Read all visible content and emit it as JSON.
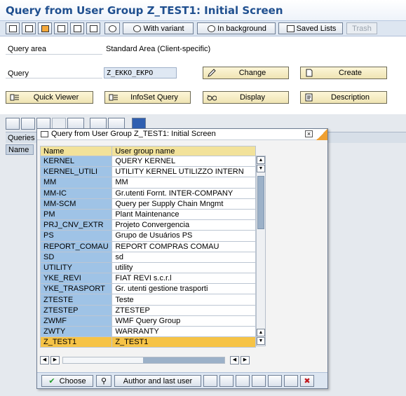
{
  "page": {
    "title": "Query from User Group Z_TEST1: Initial Screen"
  },
  "toolbar": {
    "with_variant": "With variant",
    "in_background": "In background",
    "saved_lists": "Saved Lists",
    "trash": "Trash"
  },
  "form": {
    "query_area_label": "Query area",
    "query_area_value": "Standard Area (Client-specific)",
    "query_label": "Query",
    "query_value": "Z_EKKO_EKPO"
  },
  "buttons": {
    "change": "Change",
    "create": "Create",
    "quick_viewer": "Quick Viewer",
    "infoset_query": "InfoSet Query",
    "display": "Display",
    "description": "Description"
  },
  "list": {
    "queries_label": "Queries",
    "name_header": "Name"
  },
  "popup": {
    "title": "Query from User Group Z_TEST1: Initial Screen",
    "col_name": "Name",
    "col_group": "User group name",
    "rows": [
      {
        "name": "KERNEL",
        "group": "QUERY KERNEL"
      },
      {
        "name": "KERNEL_UTILI",
        "group": "UTILITY KERNEL UTILIZZO INTERN"
      },
      {
        "name": "MM",
        "group": "MM"
      },
      {
        "name": "MM-IC",
        "group": "Gr.utenti Fornt. INTER-COMPANY"
      },
      {
        "name": "MM-SCM",
        "group": "Query per Supply Chain Mngmt"
      },
      {
        "name": "PM",
        "group": "Plant  Maintenance"
      },
      {
        "name": "PRJ_CNV_EXTR",
        "group": "Projeto Convergencia"
      },
      {
        "name": "PS",
        "group": "Grupo de Usuários PS"
      },
      {
        "name": "REPORT_COMAU",
        "group": "REPORT COMPRAS COMAU"
      },
      {
        "name": "SD",
        "group": "sd"
      },
      {
        "name": "UTILITY",
        "group": "utility"
      },
      {
        "name": "YKE_REVI",
        "group": "FIAT REVI s.c.r.l"
      },
      {
        "name": "YKE_TRASPORT",
        "group": "Gr. utenti gestione trasporti"
      },
      {
        "name": "ZTESTE",
        "group": "Teste"
      },
      {
        "name": "ZTESTEP",
        "group": "ZTESTEP"
      },
      {
        "name": "ZWMF",
        "group": "WMF Query Group"
      },
      {
        "name": "ZWTY",
        "group": "WARRANTY"
      },
      {
        "name": "Z_TEST1",
        "group": "Z_TEST1"
      }
    ],
    "choose": "Choose",
    "author_last_user": "Author and last user"
  },
  "colors": {
    "title": "#1f4f8f",
    "selected_row": "#f6c346",
    "name_column": "#9fc3e6",
    "header_row": "#f2e29a"
  }
}
